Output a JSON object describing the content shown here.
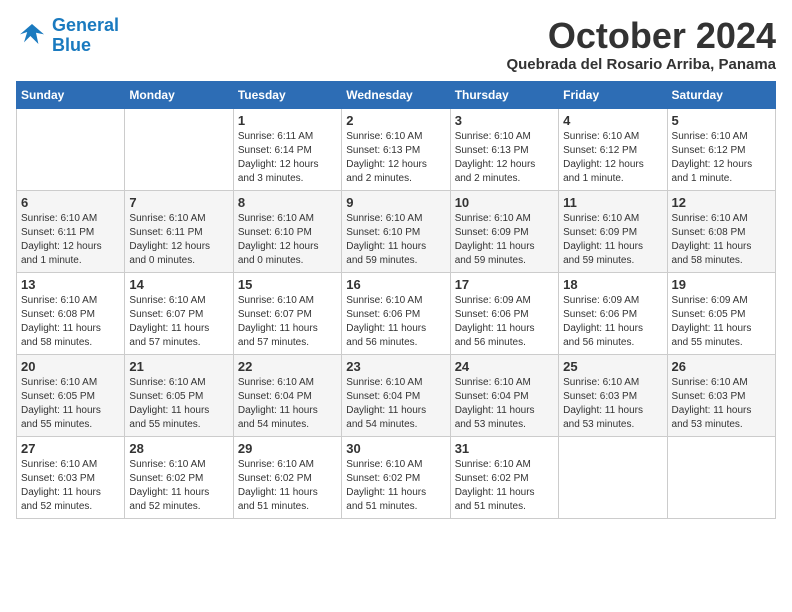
{
  "logo": {
    "line1": "General",
    "line2": "Blue"
  },
  "title": "October 2024",
  "subtitle": "Quebrada del Rosario Arriba, Panama",
  "weekdays": [
    "Sunday",
    "Monday",
    "Tuesday",
    "Wednesday",
    "Thursday",
    "Friday",
    "Saturday"
  ],
  "weeks": [
    [
      {
        "day": "",
        "info": ""
      },
      {
        "day": "",
        "info": ""
      },
      {
        "day": "1",
        "info": "Sunrise: 6:11 AM\nSunset: 6:14 PM\nDaylight: 12 hours\nand 3 minutes."
      },
      {
        "day": "2",
        "info": "Sunrise: 6:10 AM\nSunset: 6:13 PM\nDaylight: 12 hours\nand 2 minutes."
      },
      {
        "day": "3",
        "info": "Sunrise: 6:10 AM\nSunset: 6:13 PM\nDaylight: 12 hours\nand 2 minutes."
      },
      {
        "day": "4",
        "info": "Sunrise: 6:10 AM\nSunset: 6:12 PM\nDaylight: 12 hours\nand 1 minute."
      },
      {
        "day": "5",
        "info": "Sunrise: 6:10 AM\nSunset: 6:12 PM\nDaylight: 12 hours\nand 1 minute."
      }
    ],
    [
      {
        "day": "6",
        "info": "Sunrise: 6:10 AM\nSunset: 6:11 PM\nDaylight: 12 hours\nand 1 minute."
      },
      {
        "day": "7",
        "info": "Sunrise: 6:10 AM\nSunset: 6:11 PM\nDaylight: 12 hours\nand 0 minutes."
      },
      {
        "day": "8",
        "info": "Sunrise: 6:10 AM\nSunset: 6:10 PM\nDaylight: 12 hours\nand 0 minutes."
      },
      {
        "day": "9",
        "info": "Sunrise: 6:10 AM\nSunset: 6:10 PM\nDaylight: 11 hours\nand 59 minutes."
      },
      {
        "day": "10",
        "info": "Sunrise: 6:10 AM\nSunset: 6:09 PM\nDaylight: 11 hours\nand 59 minutes."
      },
      {
        "day": "11",
        "info": "Sunrise: 6:10 AM\nSunset: 6:09 PM\nDaylight: 11 hours\nand 59 minutes."
      },
      {
        "day": "12",
        "info": "Sunrise: 6:10 AM\nSunset: 6:08 PM\nDaylight: 11 hours\nand 58 minutes."
      }
    ],
    [
      {
        "day": "13",
        "info": "Sunrise: 6:10 AM\nSunset: 6:08 PM\nDaylight: 11 hours\nand 58 minutes."
      },
      {
        "day": "14",
        "info": "Sunrise: 6:10 AM\nSunset: 6:07 PM\nDaylight: 11 hours\nand 57 minutes."
      },
      {
        "day": "15",
        "info": "Sunrise: 6:10 AM\nSunset: 6:07 PM\nDaylight: 11 hours\nand 57 minutes."
      },
      {
        "day": "16",
        "info": "Sunrise: 6:10 AM\nSunset: 6:06 PM\nDaylight: 11 hours\nand 56 minutes."
      },
      {
        "day": "17",
        "info": "Sunrise: 6:09 AM\nSunset: 6:06 PM\nDaylight: 11 hours\nand 56 minutes."
      },
      {
        "day": "18",
        "info": "Sunrise: 6:09 AM\nSunset: 6:06 PM\nDaylight: 11 hours\nand 56 minutes."
      },
      {
        "day": "19",
        "info": "Sunrise: 6:09 AM\nSunset: 6:05 PM\nDaylight: 11 hours\nand 55 minutes."
      }
    ],
    [
      {
        "day": "20",
        "info": "Sunrise: 6:10 AM\nSunset: 6:05 PM\nDaylight: 11 hours\nand 55 minutes."
      },
      {
        "day": "21",
        "info": "Sunrise: 6:10 AM\nSunset: 6:05 PM\nDaylight: 11 hours\nand 55 minutes."
      },
      {
        "day": "22",
        "info": "Sunrise: 6:10 AM\nSunset: 6:04 PM\nDaylight: 11 hours\nand 54 minutes."
      },
      {
        "day": "23",
        "info": "Sunrise: 6:10 AM\nSunset: 6:04 PM\nDaylight: 11 hours\nand 54 minutes."
      },
      {
        "day": "24",
        "info": "Sunrise: 6:10 AM\nSunset: 6:04 PM\nDaylight: 11 hours\nand 53 minutes."
      },
      {
        "day": "25",
        "info": "Sunrise: 6:10 AM\nSunset: 6:03 PM\nDaylight: 11 hours\nand 53 minutes."
      },
      {
        "day": "26",
        "info": "Sunrise: 6:10 AM\nSunset: 6:03 PM\nDaylight: 11 hours\nand 53 minutes."
      }
    ],
    [
      {
        "day": "27",
        "info": "Sunrise: 6:10 AM\nSunset: 6:03 PM\nDaylight: 11 hours\nand 52 minutes."
      },
      {
        "day": "28",
        "info": "Sunrise: 6:10 AM\nSunset: 6:02 PM\nDaylight: 11 hours\nand 52 minutes."
      },
      {
        "day": "29",
        "info": "Sunrise: 6:10 AM\nSunset: 6:02 PM\nDaylight: 11 hours\nand 51 minutes."
      },
      {
        "day": "30",
        "info": "Sunrise: 6:10 AM\nSunset: 6:02 PM\nDaylight: 11 hours\nand 51 minutes."
      },
      {
        "day": "31",
        "info": "Sunrise: 6:10 AM\nSunset: 6:02 PM\nDaylight: 11 hours\nand 51 minutes."
      },
      {
        "day": "",
        "info": ""
      },
      {
        "day": "",
        "info": ""
      }
    ]
  ]
}
